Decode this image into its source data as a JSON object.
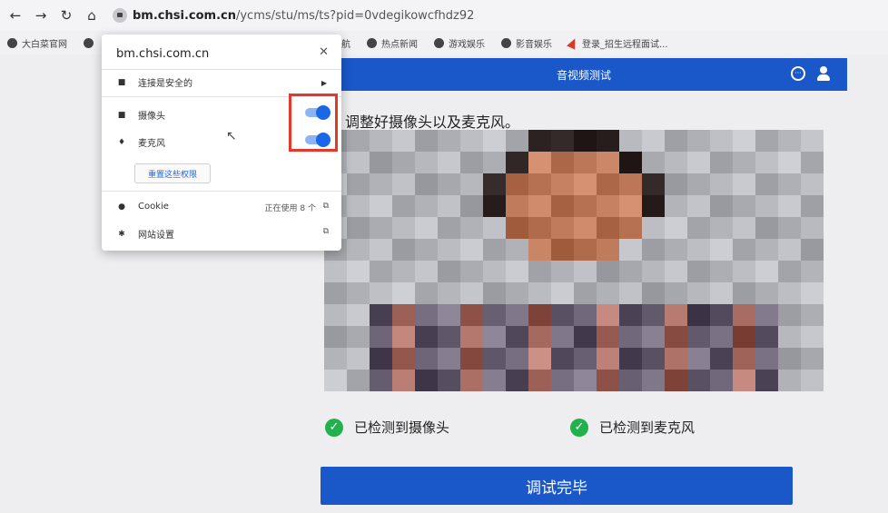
{
  "browser": {
    "url_host": "bm.chsi.com.cn",
    "url_path": "/ycms/stu/ms/ts?pid=0vdegikowcfhdz92",
    "bookmarks": [
      "大白菜官网",
      "网址导航",
      "热点新闻",
      "游戏娱乐",
      "影音娱乐",
      "登录_招生远程面试..."
    ]
  },
  "popup": {
    "domain": "bm.chsi.com.cn",
    "connection": "连接是安全的",
    "camera": "摄像头",
    "microphone": "麦克风",
    "camera_enabled": true,
    "microphone_enabled": true,
    "reset": "重置这些权限",
    "cookie": "Cookie",
    "cookie_info": "正在使用 8 个",
    "site_settings": "网站设置"
  },
  "page": {
    "header_title": "音视频测试",
    "instruction": "调整好摄像头以及麦克风。",
    "camera_status": "已检测到摄像头",
    "mic_status": "已检测到麦克风",
    "done_button": "调试完毕"
  },
  "colors": {
    "brand_blue": "#1a57c8",
    "success_green": "#22b14c",
    "highlight_red": "#e53828"
  }
}
